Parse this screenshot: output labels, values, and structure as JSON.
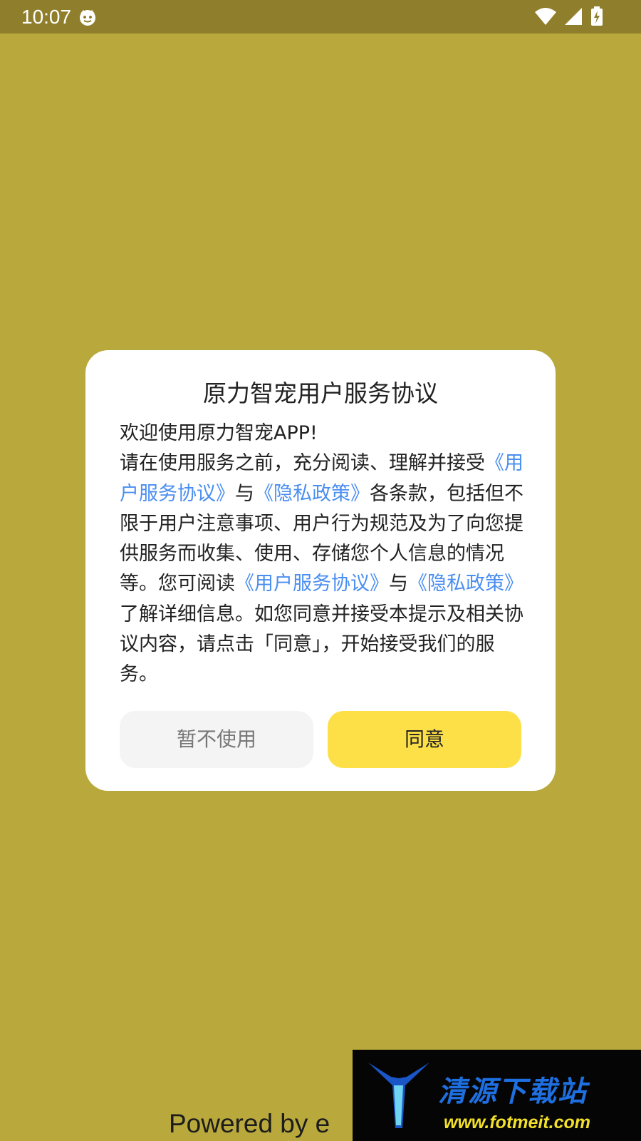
{
  "status_bar": {
    "time": "10:07",
    "icons": [
      "app-face-icon",
      "wifi-icon",
      "cell-signal-icon",
      "battery-charging-icon"
    ]
  },
  "colors": {
    "background": "#b9a93c",
    "status_bar": "#8f7f2d",
    "link": "#4a8ef0",
    "agree_button": "#fde047",
    "decline_button": "#f4f4f4"
  },
  "dialog": {
    "title": "原力智宠用户服务协议",
    "welcome": "欢迎使用原力智宠APP!",
    "p1": "请在使用服务之前，充分阅读、理解并接受",
    "link_user_agreement": "《用户服务协议》",
    "with1": "与",
    "link_privacy": "《隐私政策》",
    "p2": "各条款，包括但不限于用户注意事项、用户行为规范及为了向您提供服务而收集、使用、存储您个人信息的情况等。您可阅读",
    "link_user_agreement_2": "《用户服务协议》",
    "with2": "与",
    "link_privacy_2": "《隐私政策》",
    "p3": "了解详细信息。如您同意并接受本提示及相关协议内容，请点击「同意」，开始接受我们的服务。",
    "decline_label": "暂不使用",
    "agree_label": "同意"
  },
  "footer": {
    "powered_by": "Powered by  e"
  },
  "watermark": {
    "title": "清源下载站",
    "url": "www.fotmeit.com"
  }
}
